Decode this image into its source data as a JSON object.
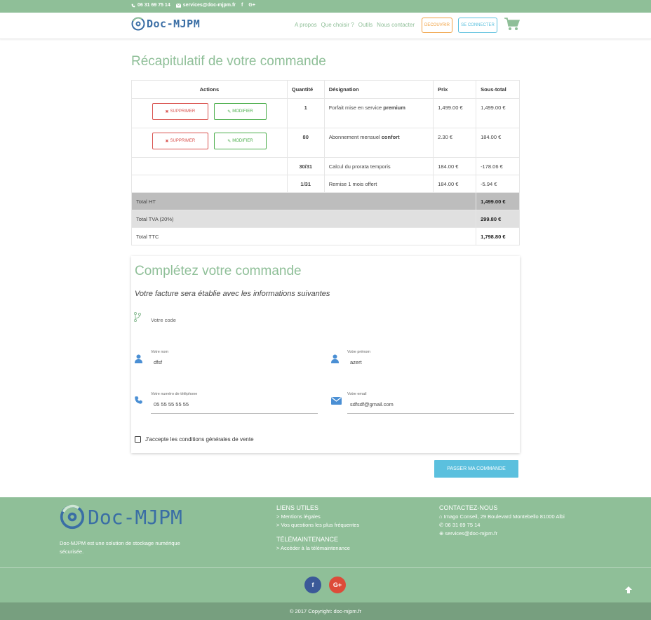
{
  "topbar": {
    "phone": "06 31 69 75 14",
    "email": "services@doc-mjpm.fr"
  },
  "brand": {
    "logo_text": "Doc-MJPM"
  },
  "nav": {
    "links": [
      "A propos",
      "Que choisir ?",
      "Outils",
      "Nous contacter"
    ],
    "discover": "DECOUVRIR",
    "connect": "SE CONNECTER"
  },
  "page": {
    "title": "Récapitulatif de votre commande"
  },
  "table": {
    "headers": {
      "actions": "Actions",
      "qty": "Quantité",
      "designation": "Désignation",
      "price": "Prix",
      "subtotal": "Sous-total"
    },
    "delete_label": "SUPPRIMER",
    "edit_label": "MODIFIER",
    "rows": [
      {
        "qty": "1",
        "designation": "Forfait mise en service",
        "designation_bold": "premium",
        "price": "1,499.00 €",
        "subtotal": "1,499.00 €"
      },
      {
        "qty": "80",
        "designation": "Abonnement mensuel",
        "designation_bold": "confort",
        "price": "2.30 €",
        "subtotal": "184.00 €"
      },
      {
        "qty": "30/31",
        "designation": "Calcul du prorata temporis",
        "price": "184.00 €",
        "subtotal": "-178.06 €"
      },
      {
        "qty": "1/31",
        "designation": "Remise 1 mois offert",
        "price": "184.00 €",
        "subtotal": "-5.94 €"
      }
    ],
    "totals": [
      {
        "label": "Total HT",
        "value": "1,499.00 €"
      },
      {
        "label": "Total TVA (20%)",
        "value": "299.80 €"
      },
      {
        "label": "Total TTC",
        "value": "1,798.80 €"
      }
    ]
  },
  "form": {
    "title": "Complétez votre commande",
    "subtitle": "Votre facture sera établie avec les informations suivantes",
    "code_placeholder": "Votre code",
    "nom_label": "Votre nom",
    "nom_value": "dfsf",
    "prenom_label": "Votre prénom",
    "prenom_value": "azert",
    "phone_label": "Votre numéro de téléphone",
    "phone_value": "05 55 55 55 55",
    "email_label": "Votre email",
    "email_value": "sdfsdf@gmail.com",
    "cgv": "J'accepte les conditions générales de vente"
  },
  "order_button": "PASSER MA COMMANDE",
  "footer": {
    "description": "Doc-MJPM est une solution de stockage numérique sécurisée.",
    "links_title": "LIENS UTILES",
    "links": [
      "> Mentions légales",
      "> Vos questions les plus fréquentes"
    ],
    "tele_title": "TÉLÉMAINTENANCE",
    "tele_link": "> Accéder à la télémaintenance",
    "contact_title": "CONTACTEZ-NOUS",
    "address": "Imago Conseil, 29 Boulevard Montebello 81000 Albi",
    "phone": "06 31 69 75 14",
    "email": "services@doc-mjpm.fr",
    "copyright_prefix": "© 2017 Copyright:",
    "copyright_site": "doc-mjpm.fr"
  }
}
